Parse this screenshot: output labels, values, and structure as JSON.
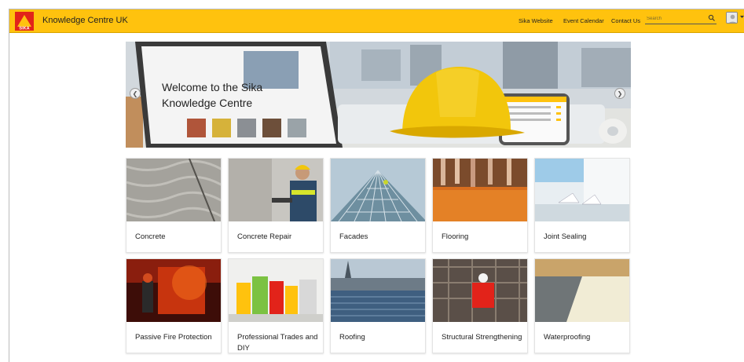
{
  "header": {
    "title": "Knowledge Centre UK",
    "logo_text": "SIKA",
    "nav": [
      "Sika Website",
      "Event Calendar",
      "Contact Us"
    ],
    "search_placeholder": "Search",
    "brand_color": "#ffc20e",
    "logo_color": "#e2231a"
  },
  "banner": {
    "title": "Welcome to the Sika Knowledge Centre",
    "prev_icon": "chevron-left-icon",
    "next_icon": "chevron-right-icon"
  },
  "categories": [
    {
      "label": "Concrete"
    },
    {
      "label": "Concrete Repair"
    },
    {
      "label": "Facades"
    },
    {
      "label": "Flooring"
    },
    {
      "label": "Joint Sealing"
    },
    {
      "label": "Passive Fire Protection"
    },
    {
      "label": "Professional Trades and DIY"
    },
    {
      "label": "Roofing"
    },
    {
      "label": "Structural Strengthening"
    },
    {
      "label": "Waterproofing"
    }
  ]
}
